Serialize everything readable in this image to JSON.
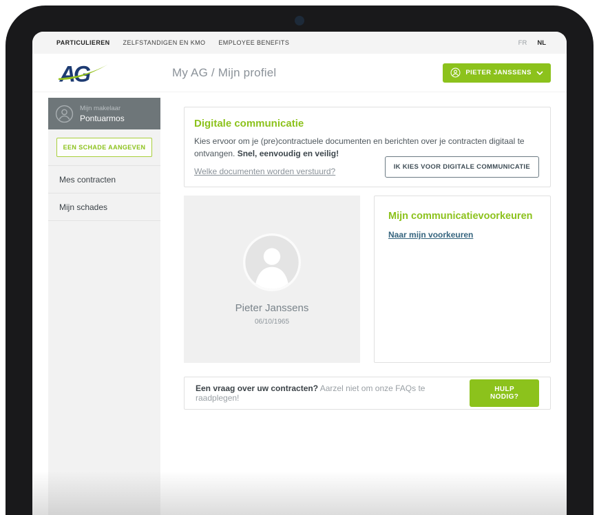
{
  "topnav": {
    "items": [
      "PARTICULIEREN",
      "ZELFSTANDIGEN EN KMO",
      "EMPLOYEE BENEFITS"
    ],
    "languages": [
      "FR",
      "NL"
    ],
    "active_language": "NL"
  },
  "header": {
    "logo_text": "AG",
    "title": "My AG / Mijn profiel",
    "user_button_label": "PIETER JANSSENS"
  },
  "sidebar": {
    "broker": {
      "label": "Mijn makelaar",
      "name": "Pontuarmos"
    },
    "claim_button_label": "EEN SCHADE AANGEVEN",
    "items": [
      {
        "label": "Mes contracten"
      },
      {
        "label": "Mijn schades"
      }
    ]
  },
  "digital_panel": {
    "title": "Digitale communicatie",
    "body": "Kies ervoor om je (pre)contractuele documenten en berichten over je contracten digitaal te ontvangen. ",
    "body_bold": "Snel, eenvoudig en veilig!",
    "link": "Welke documenten worden verstuurd?",
    "button_label": "IK KIES VOOR DIGITALE COMMUNICATIE"
  },
  "profile_card": {
    "name": "Pieter Janssens",
    "birthdate": "06/10/1965"
  },
  "preferences_card": {
    "title": "Mijn communicatievoorkeuren",
    "link": "Naar mijn voorkeuren"
  },
  "help_bar": {
    "question_bold": "Een vraag over uw contracten?",
    "question_rest": " Aarzel niet om onze FAQs te raadplegen!",
    "button_label": "HULP NODIG?"
  },
  "colors": {
    "brand_green": "#8cc21c",
    "brand_navy": "#1d3b72",
    "broker_box_gray": "#6e7679",
    "link_blue": "#35647e",
    "bezel_black": "#19191b"
  }
}
